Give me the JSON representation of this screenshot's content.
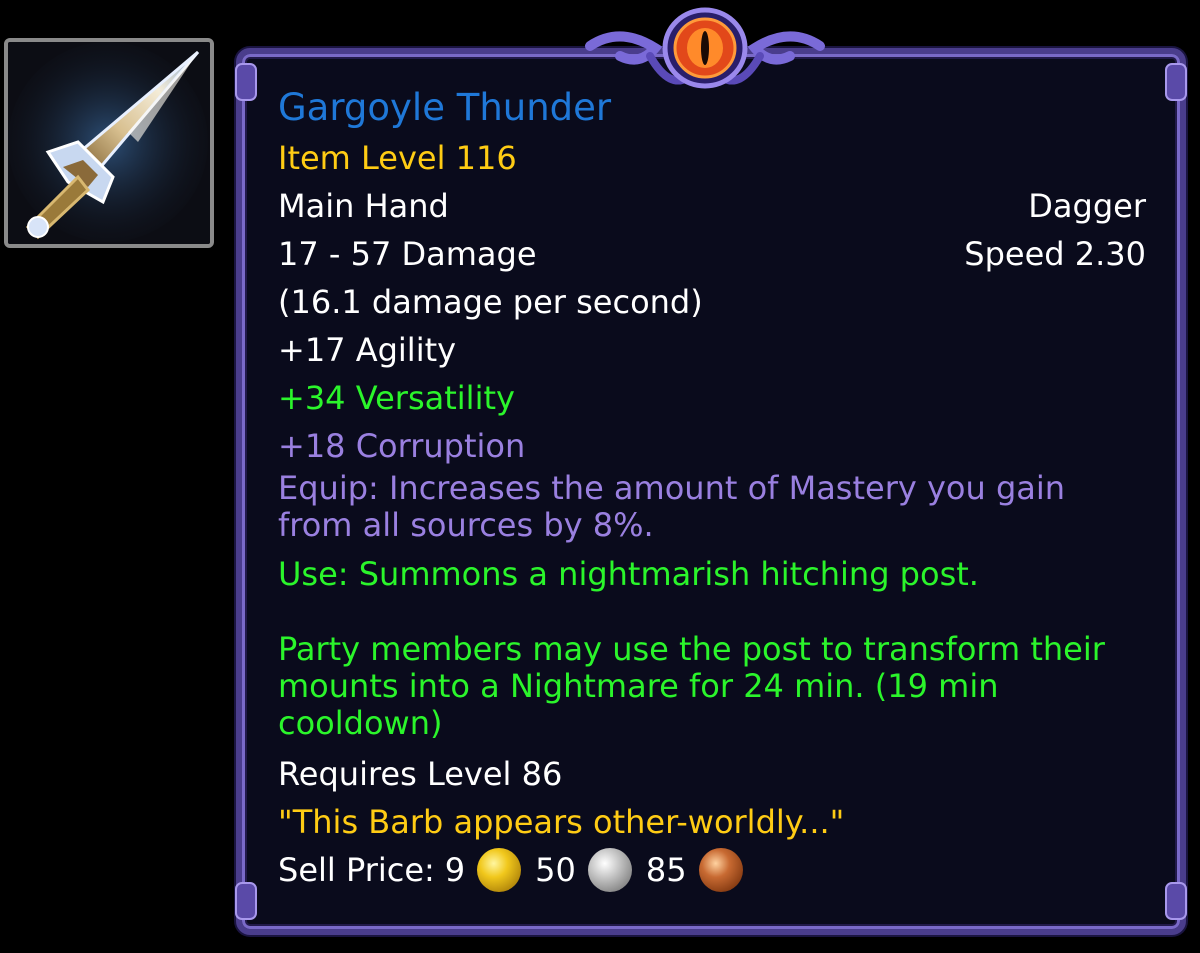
{
  "item": {
    "name": "Gargoyle Thunder",
    "item_level": "Item Level 116",
    "slot": "Main Hand",
    "type": "Dagger",
    "damage": "17 - 57 Damage",
    "speed": "Speed 2.30",
    "dps": "(16.1 damage per second)",
    "stat_agility": "+17 Agility",
    "stat_versatility": "+34 Versatility",
    "stat_corruption": "+18 Corruption",
    "equip_effect": "Equip: Increases the amount of Mastery you gain from all sources by 8%.",
    "use_effect": "Use: Summons a nightmarish hitching post.",
    "use_effect_detail": "Party members may use the post to transform their mounts into a Nightmare for 24 min. (19 min cooldown)",
    "requires_level": "Requires Level 86",
    "flavor_text": "\"This Barb appears other-worldly...\"",
    "sell_price_label": "Sell Price:",
    "sell_gold": "9",
    "sell_silver": "50",
    "sell_copper": "85",
    "icon": "dagger-icon"
  },
  "colors": {
    "name": "#1f78d8",
    "item_level": "#ffcc14",
    "versatility_use": "#2bf52b",
    "corruption": "#9a80e0",
    "flavor": "#ffcc14",
    "frame": "#4a3d8c"
  }
}
